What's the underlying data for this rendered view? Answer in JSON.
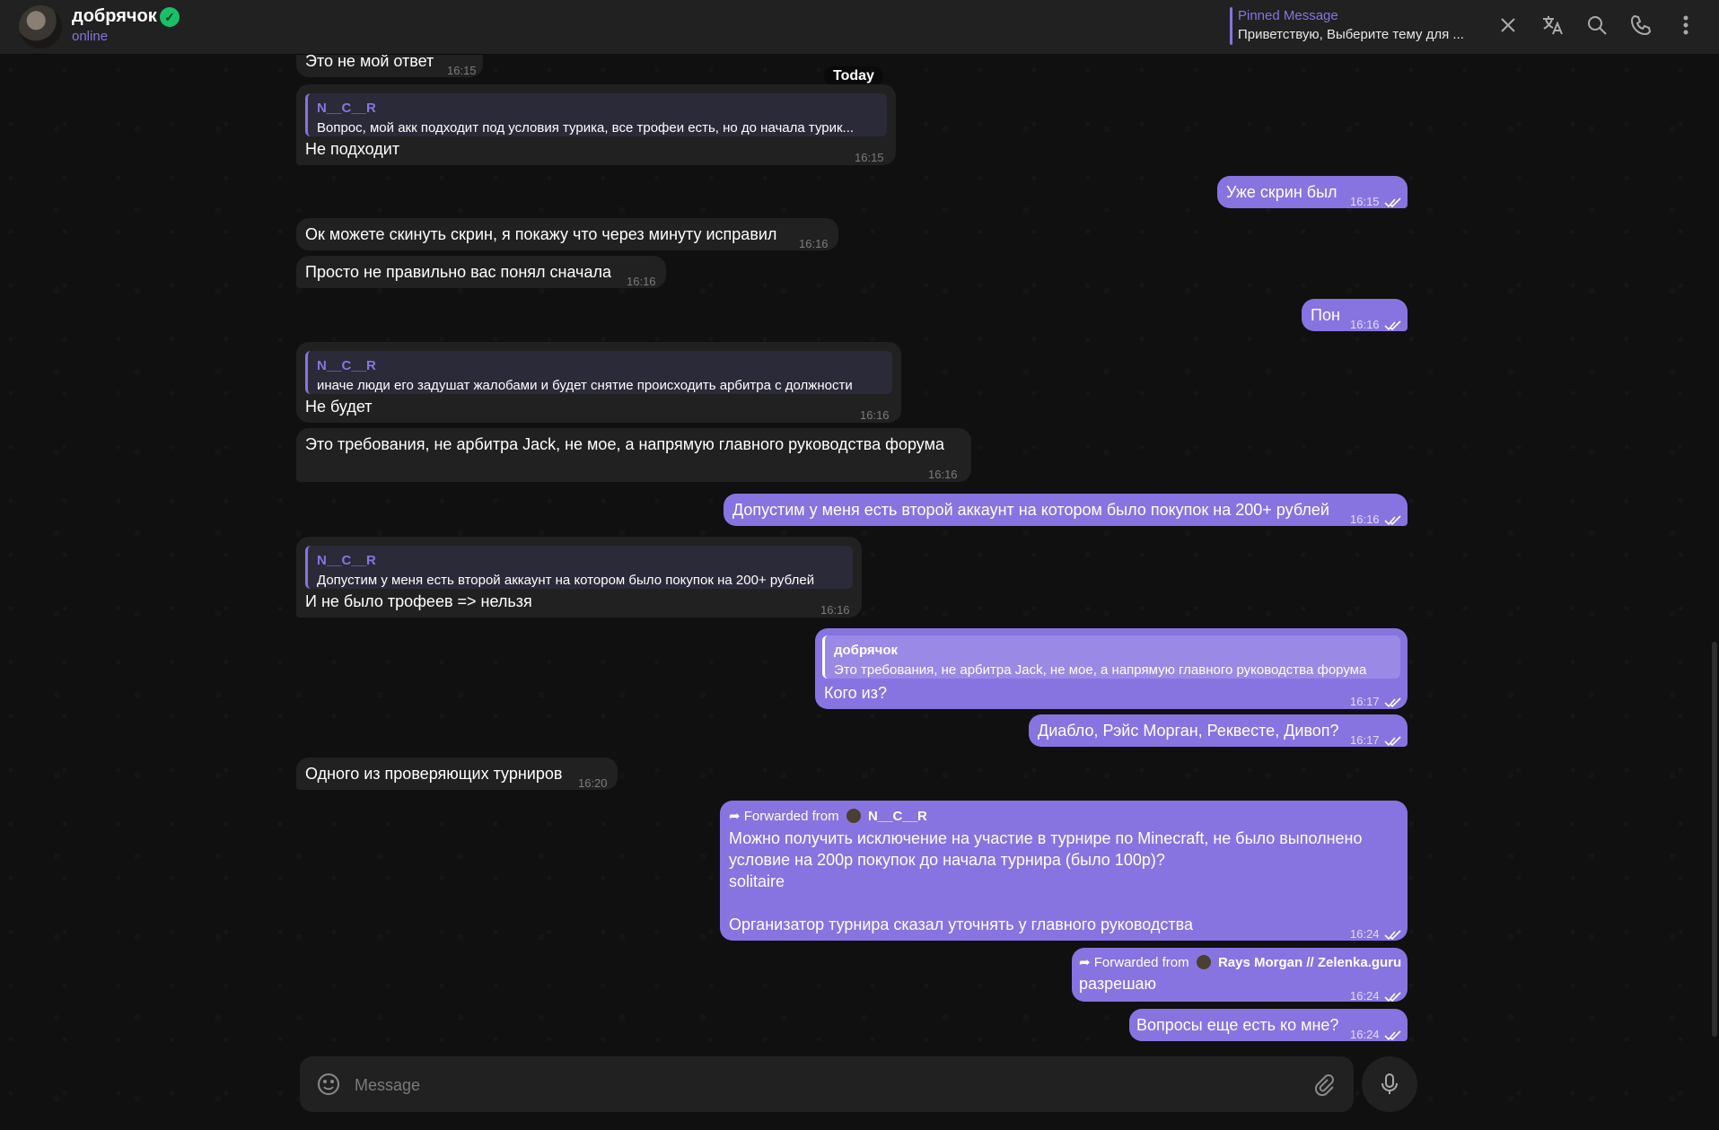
{
  "header": {
    "chat_name": "добрячок",
    "status": "online",
    "pinned_title": "Pinned Message",
    "pinned_text": "Приветствую, Выберите тему для ...",
    "icons": [
      "close-icon",
      "translate-icon",
      "search-icon",
      "phone-icon",
      "more-icon"
    ]
  },
  "date_separator": "Today",
  "messages": [
    {
      "dir": "in",
      "text": "Это не мой ответ",
      "time": "16:15"
    },
    {
      "dir": "in",
      "reply_name": "N__C__R",
      "reply_text": "Вопрос, мой акк подходит под условия турика, все трофеи есть, но до начала турик...",
      "text": "Не подходит",
      "time": "16:15"
    },
    {
      "dir": "out",
      "text": "Уже скрин был",
      "time": "16:15"
    },
    {
      "dir": "in",
      "text": "Ок можете скинуть скрин, я покажу что через минуту исправил",
      "time": "16:16"
    },
    {
      "dir": "in",
      "text": "Просто не правильно вас понял сначала",
      "time": "16:16"
    },
    {
      "dir": "out",
      "text": "Пон",
      "time": "16:16"
    },
    {
      "dir": "in",
      "reply_name": "N__C__R",
      "reply_text": "иначе люди его задушат жалобами и будет снятие происходить арбитра с должности",
      "text": "Не будет",
      "time": "16:16"
    },
    {
      "dir": "in",
      "text": "Это требования, не арбитра Jack, не мое, а напрямую главного руководства форума",
      "time": "16:16"
    },
    {
      "dir": "out",
      "text": "Допустим у меня есть второй аккаунт на котором было покупок на 200+ рублей",
      "time": "16:16"
    },
    {
      "dir": "in",
      "reply_name": "N__C__R",
      "reply_text": "Допустим у меня есть второй аккаунт на котором было покупок на 200+ рублей",
      "text": "И не было трофеев => нельзя",
      "time": "16:16"
    },
    {
      "dir": "out",
      "reply_name": "добрячок",
      "reply_text": "Это требования, не арбитра Jack, не мое, а напрямую главного руководства форума",
      "text": "Кого из?",
      "time": "16:17"
    },
    {
      "dir": "out",
      "text": "Диабло, Рэйс Морган, Реквесте, Дивоп?",
      "time": "16:17"
    },
    {
      "dir": "in",
      "text": "Одного из проверяющих турниров",
      "time": "16:20"
    },
    {
      "dir": "out",
      "fwd_label": "Forwarded from",
      "fwd_name": "N__C__R",
      "lines": [
        "Можно получить исключение на участие в турнире по Minecraft, не было выполнено",
        "условие на 200р покупок до начала турнира (было 100р)?",
        "solitaire",
        "",
        "Организатор турнира сказал уточнять у главного руководства"
      ],
      "time": "16:24"
    },
    {
      "dir": "out",
      "fwd_label": "Forwarded from",
      "fwd_name": "Rays Morgan // Zelenka.guru",
      "text": "разрешаю",
      "time": "16:24"
    },
    {
      "dir": "out",
      "text": "Вопросы еще есть ко мне?",
      "time": "16:24"
    }
  ],
  "composer": {
    "placeholder": "Message"
  },
  "colors": {
    "accent": "#8774e1",
    "incoming": "#212121",
    "background": "#0f0f0f",
    "verified": "#19c068"
  }
}
